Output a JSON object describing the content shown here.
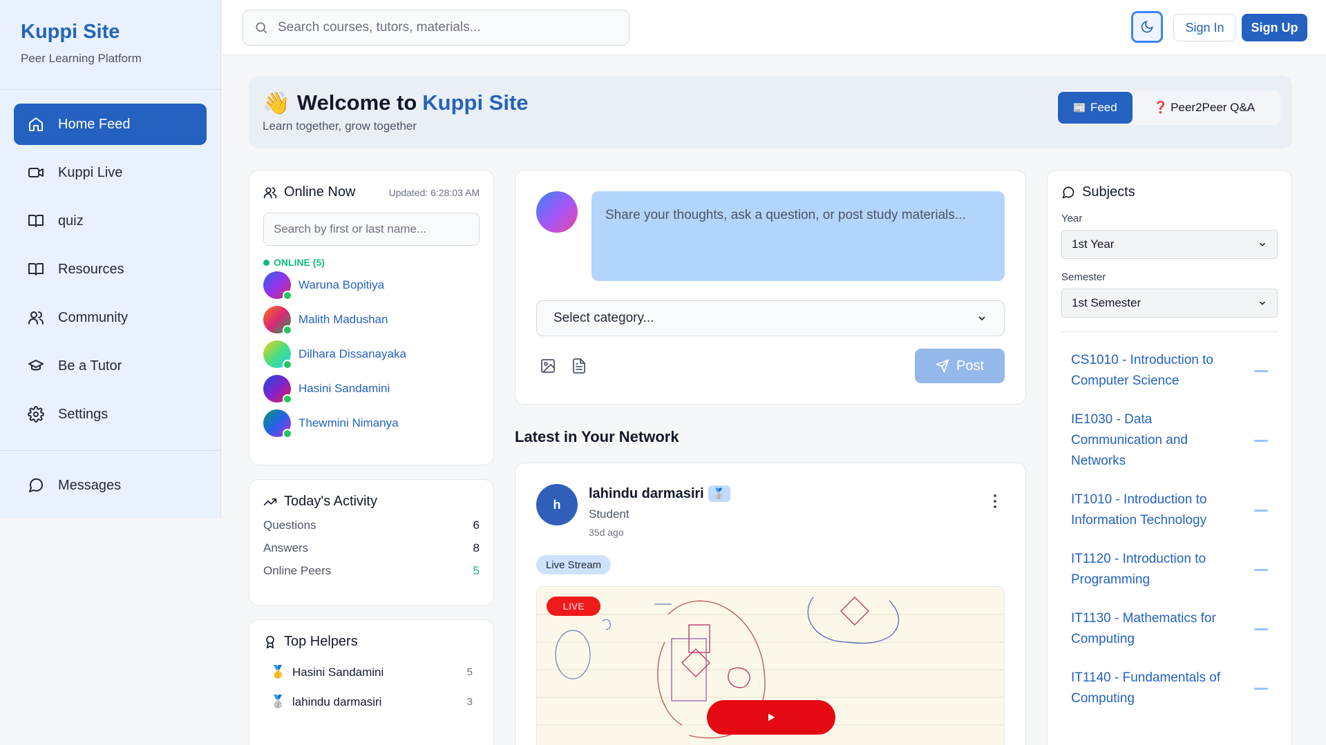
{
  "brand": {
    "title": "Kuppi Site",
    "subtitle": "Peer Learning Platform"
  },
  "sidebar": {
    "items": [
      {
        "label": "Home Feed",
        "icon": "home-icon",
        "active": true
      },
      {
        "label": "Kuppi Live",
        "icon": "video-icon"
      },
      {
        "label": "quiz",
        "icon": "book-icon"
      },
      {
        "label": "Resources",
        "icon": "book-icon"
      },
      {
        "label": "Community",
        "icon": "users-icon"
      },
      {
        "label": "Be a Tutor",
        "icon": "graduation-cap-icon"
      },
      {
        "label": "Settings",
        "icon": "gear-icon"
      }
    ],
    "messages": {
      "label": "Messages",
      "icon": "message-circle-icon"
    }
  },
  "topbar": {
    "search_placeholder": "Search courses, tutors, materials...",
    "signin": "Sign In",
    "signup": "Sign Up"
  },
  "welcome": {
    "emoji": "👋",
    "title_prefix": "Welcome to",
    "title_accent": "Kuppi Site",
    "subtitle": "Learn together, grow together",
    "tab_feed": "Feed",
    "tab_feed_icon": "📰",
    "tab_qa": "Peer2Peer Q&A",
    "tab_qa_icon": "❓"
  },
  "online": {
    "title": "Online Now",
    "updated": "Updated: 6:28:03 AM",
    "search_placeholder": "Search by first or last name...",
    "label": "ONLINE (5)",
    "users": [
      {
        "name": "Waruna Bopitiya"
      },
      {
        "name": "Malith Madushan"
      },
      {
        "name": "Dilhara Dissanayaka"
      },
      {
        "name": "Hasini Sandamini"
      },
      {
        "name": "Thewmini Nimanya"
      }
    ]
  },
  "activity": {
    "title": "Today's Activity",
    "rows": [
      {
        "label": "Questions",
        "value": "6"
      },
      {
        "label": "Answers",
        "value": "8"
      },
      {
        "label": "Online Peers",
        "value": "5"
      }
    ]
  },
  "helpers": {
    "title": "Top Helpers",
    "rows": [
      {
        "medal": "🥇",
        "name": "Hasini Sandamini",
        "count": "5"
      },
      {
        "medal": "🥈",
        "name": "lahindu darmasiri",
        "count": "3"
      }
    ]
  },
  "composer": {
    "placeholder": "Share your thoughts, ask a question, or post study materials...",
    "category_placeholder": "Select category...",
    "post": "Post"
  },
  "feed": {
    "heading": "Latest in Your Network",
    "post": {
      "avatar_letter": "h",
      "author": "lahindu darmasiri",
      "badge": "🥈",
      "role": "Student",
      "time": "35d ago",
      "tag": "Live Stream",
      "live_label": "LIVE"
    }
  },
  "subjects": {
    "title": "Subjects",
    "year_label": "Year",
    "year_value": "1st Year",
    "semester_label": "Semester",
    "semester_value": "1st Semester",
    "items": [
      {
        "name": "CS1010 - Introduction to Computer Science"
      },
      {
        "name": "IE1030 - Data Communication and Networks"
      },
      {
        "name": "IT1010 - Introduction to Information Technology"
      },
      {
        "name": "IT1120 - Introduction to Programming"
      },
      {
        "name": "IT1130 - Mathematics for Computing"
      },
      {
        "name": "IT1140 - Fundamentals of Computing"
      }
    ]
  },
  "colors": {
    "primary": "#2461c0",
    "accent": "#2563b8",
    "online": "#10b981",
    "live": "#ef1a1a"
  }
}
